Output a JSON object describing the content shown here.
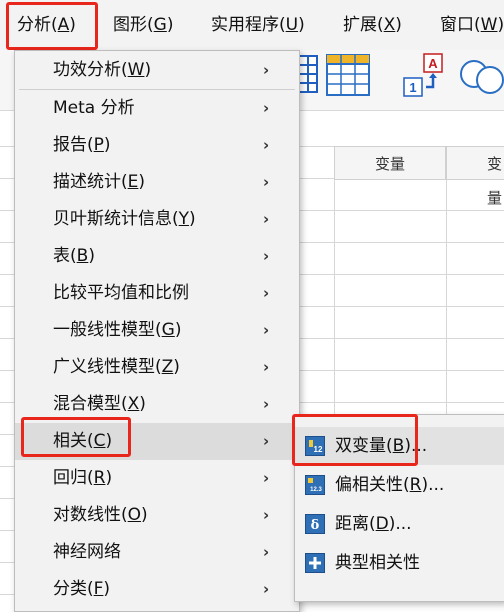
{
  "menubar": {
    "items": [
      {
        "name": "分析",
        "key": "A"
      },
      {
        "name": "图形",
        "key": "G"
      },
      {
        "name": "实用程序",
        "key": "U"
      },
      {
        "name": "扩展",
        "key": "X"
      },
      {
        "name": "窗口",
        "key": "W"
      }
    ]
  },
  "grid": {
    "columns": [
      "变量",
      "变量"
    ]
  },
  "analyze_menu": {
    "items": [
      {
        "name": "功效分析",
        "key": "W",
        "has_submenu": true
      },
      {
        "name": "Meta 分析",
        "key": "",
        "has_submenu": true
      },
      {
        "name": "报告",
        "key": "P",
        "has_submenu": true
      },
      {
        "name": "描述统计",
        "key": "E",
        "has_submenu": true
      },
      {
        "name": "贝叶斯统计信息",
        "key": "Y",
        "has_submenu": true
      },
      {
        "name": "表",
        "key": "B",
        "has_submenu": true
      },
      {
        "name": "比较平均值和比例",
        "key": "",
        "has_submenu": true
      },
      {
        "name": "一般线性模型",
        "key": "G",
        "has_submenu": true
      },
      {
        "name": "广义线性模型",
        "key": "Z",
        "has_submenu": true
      },
      {
        "name": "混合模型",
        "key": "X",
        "has_submenu": true
      },
      {
        "name": "相关",
        "key": "C",
        "has_submenu": true
      },
      {
        "name": "回归",
        "key": "R",
        "has_submenu": true
      },
      {
        "name": "对数线性",
        "key": "O",
        "has_submenu": true
      },
      {
        "name": "神经网络",
        "key": "",
        "has_submenu": true
      },
      {
        "name": "分类",
        "key": "F",
        "has_submenu": true
      }
    ],
    "active_index": 10
  },
  "correlate_submenu": {
    "items": [
      {
        "name": "双变量",
        "key": "B",
        "suffix": "...",
        "icon": "bivariate-icon"
      },
      {
        "name": "偏相关性",
        "key": "R",
        "suffix": "...",
        "icon": "partial-correlation-icon"
      },
      {
        "name": "距离",
        "key": "D",
        "suffix": "...",
        "icon": "distance-icon"
      },
      {
        "name": "典型相关性",
        "key": "",
        "suffix": "",
        "icon": "canonical-correlation-icon"
      }
    ],
    "active_index": 0
  },
  "colors": {
    "highlight_border": "#e8261c",
    "menu_bg": "#f2f2f2",
    "icon_blue": "#2f6fb5"
  }
}
